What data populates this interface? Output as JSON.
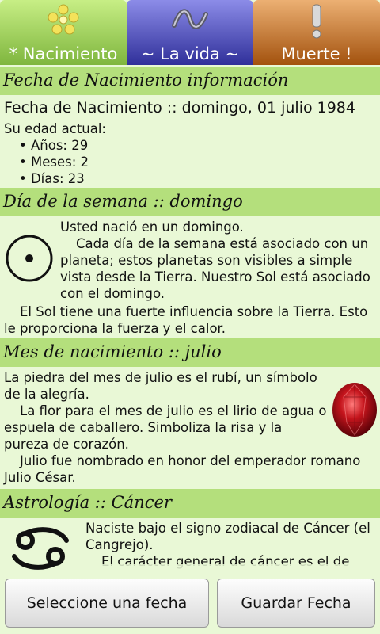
{
  "tabs": [
    {
      "label": "* Nacimiento",
      "icon": "flower-icon"
    },
    {
      "label": "~ La vida ~",
      "icon": "wave-icon"
    },
    {
      "label": "Muerte !",
      "icon": "exclamation-icon"
    }
  ],
  "birth_info": {
    "header": "Fecha de Nacimiento información",
    "date_line": "Fecha de Nacimiento :: domingo, 01 julio 1984",
    "age_label": "Su edad actual:",
    "age_items": [
      "• Años: 29",
      "• Meses: 2",
      "• Días: 23"
    ]
  },
  "weekday": {
    "header": "Día de la semana :: domingo",
    "p1": "Usted nació en un domingo.",
    "p2": "Cada día de la semana está asociado con un planeta; estos planetas son visibles a simple vista desde la Tierra. Nuestro Sol está asociado con el domingo.",
    "p3": "El Sol tiene una fuerte influencia sobre la Tierra. Esto le proporciona la fuerza y el calor.",
    "icon": "sun-symbol-icon"
  },
  "month": {
    "header": "Mes de nacimiento :: julio",
    "p1": "La piedra del mes de julio es el rubí, un símbolo de la alegría.",
    "p2": "La flor para el mes de julio es el lirio de agua o espuela de caballero. Simboliza la risa y la pureza de corazón.",
    "p3": "Julio fue nombrado en honor del emperador romano Julio César.",
    "icon": "ruby-icon"
  },
  "astrology": {
    "header": "Astrología :: Cáncer",
    "p1": "Naciste bajo el signo zodiacal de Cáncer (el Cangrejo).",
    "p2": "El carácter general de cáncer es el de una persona hogareña. Usted es un cisne",
    "icon": "cancer-sign-icon"
  },
  "buttons": {
    "select_date": "Seleccione una fecha",
    "save_date": "Guardar Fecha"
  },
  "colors": {
    "background": "#e9f8d6",
    "section_header": "#b4df7c"
  }
}
